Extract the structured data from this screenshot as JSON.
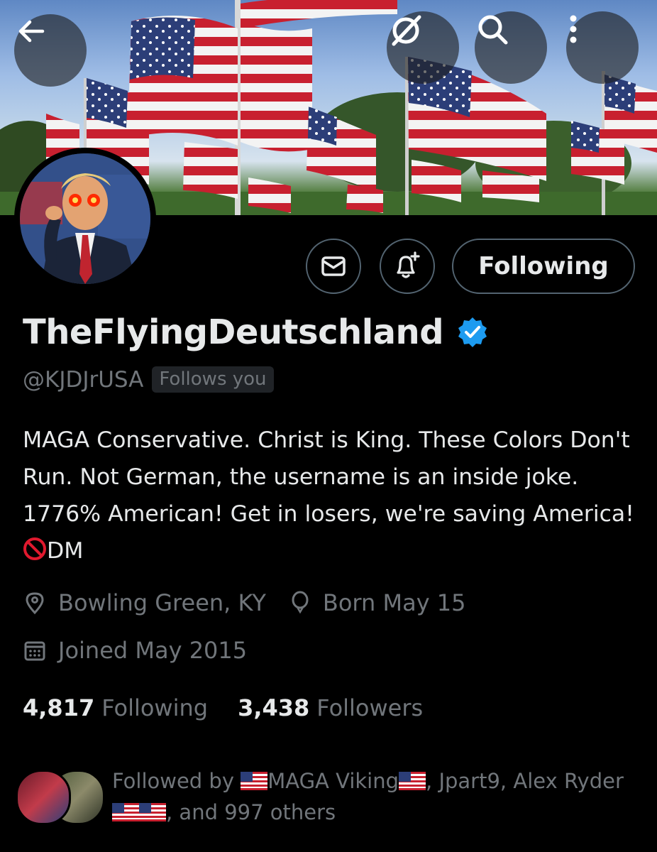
{
  "header": {
    "back_icon": "back-arrow-icon",
    "grok_icon": "grok-icon",
    "search_icon": "search-icon",
    "more_icon": "more-vertical-icon"
  },
  "actions": {
    "message_icon": "envelope-icon",
    "notify_icon": "bell-plus-icon",
    "following_label": "Following"
  },
  "profile": {
    "display_name": "TheFlyingDeutschland",
    "handle": "@KJDJrUSA",
    "follows_you": "Follows you",
    "bio_text": "MAGA Conservative. Christ is King. These Colors Don't Run. Not German, the username is an inside joke. 1776% American! Get in losers, we're saving America! ",
    "bio_tail": "DM",
    "location": "Bowling Green, KY",
    "birthday": "Born May 15",
    "joined": "Joined May 2015"
  },
  "stats": {
    "following_count": "4,817",
    "following_label": "Following",
    "followers_count": "3,438",
    "followers_label": "Followers"
  },
  "followed_by": {
    "prefix": "Followed by ",
    "name1": "MAGA Viking",
    "sep1": ", Jpart9, Alex Ryder ",
    "tail": ", and 997 others"
  },
  "colors": {
    "background": "#000000",
    "text_primary": "#e7e9ea",
    "text_secondary": "#71767b",
    "border": "#536471",
    "verified": "#1d9bf0"
  }
}
